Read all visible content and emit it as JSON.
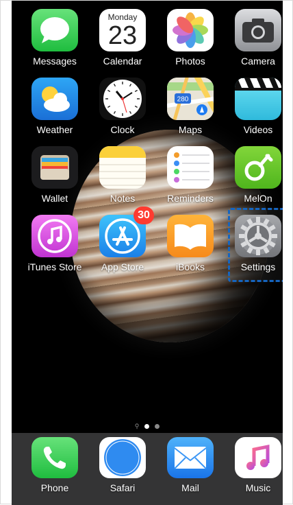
{
  "home": {
    "apps": [
      {
        "label": "Messages",
        "icon": "messages-icon"
      },
      {
        "label": "Calendar",
        "icon": "calendar-icon",
        "day_name": "Monday",
        "day_number": "23"
      },
      {
        "label": "Photos",
        "icon": "photos-icon"
      },
      {
        "label": "Camera",
        "icon": "camera-icon"
      },
      {
        "label": "Weather",
        "icon": "weather-icon"
      },
      {
        "label": "Clock",
        "icon": "clock-icon"
      },
      {
        "label": "Maps",
        "icon": "maps-icon",
        "route_number": "280"
      },
      {
        "label": "Videos",
        "icon": "videos-icon"
      },
      {
        "label": "Wallet",
        "icon": "wallet-icon"
      },
      {
        "label": "Notes",
        "icon": "notes-icon"
      },
      {
        "label": "Reminders",
        "icon": "reminders-icon"
      },
      {
        "label": "MelOn",
        "icon": "melon-icon"
      },
      {
        "label": "iTunes Store",
        "icon": "itunes-store-icon"
      },
      {
        "label": "App Store",
        "icon": "app-store-icon",
        "badge": "30"
      },
      {
        "label": "iBooks",
        "icon": "ibooks-icon"
      },
      {
        "label": "Settings",
        "icon": "settings-icon"
      }
    ],
    "page_indicator": {
      "pages": 2,
      "current": 1
    }
  },
  "dock": {
    "apps": [
      {
        "label": "Phone",
        "icon": "phone-icon"
      },
      {
        "label": "Safari",
        "icon": "safari-icon"
      },
      {
        "label": "Mail",
        "icon": "mail-icon"
      },
      {
        "label": "Music",
        "icon": "music-icon"
      }
    ]
  }
}
